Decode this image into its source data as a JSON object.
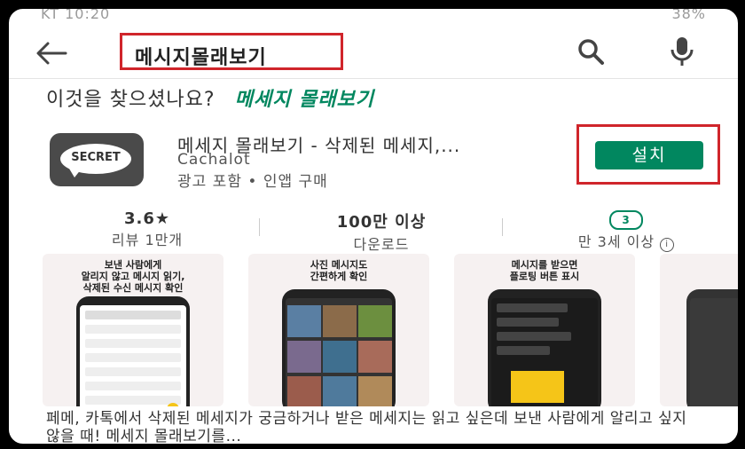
{
  "status_bar": {
    "left": "KT 10:20",
    "right": "38%"
  },
  "search": {
    "query": "메시지몰래보기"
  },
  "did_you_mean": {
    "label": "이것을 찾으셨나요?",
    "suggestion": "메세지 몰래보기"
  },
  "app": {
    "icon_text": "SECRET",
    "title": "메세지 몰래보기 - 삭제된 메세지,...",
    "developer": "Cachalot",
    "ad_label": "광고 포함",
    "iap_label": "인앱 구매",
    "install_label": "설치"
  },
  "stats": {
    "rating_value": "3.6★",
    "rating_label": "리뷰 1만개",
    "downloads_value": "100만 이상",
    "downloads_label": "다운로드",
    "age_badge": "3",
    "age_label": "만 3세 이상"
  },
  "screenshots": [
    {
      "caption": "보낸 사람에게\n알리지 않고 메시지 읽기,\n삭제된 수신 메시지 확인"
    },
    {
      "caption": "사진 메시지도\n간편하게 확인"
    },
    {
      "caption": "메시지를 받으면\n플로팅 버튼 표시"
    }
  ],
  "description": "페메, 카톡에서 삭제된 메세지가 궁금하거나 받은 메세지는 읽고 싶은데 보낸 사람에게 알리고 싶지 않을 때! 메세지 몰래보기를...",
  "colors": {
    "accent": "#01875f",
    "highlight": "#d0252b"
  }
}
